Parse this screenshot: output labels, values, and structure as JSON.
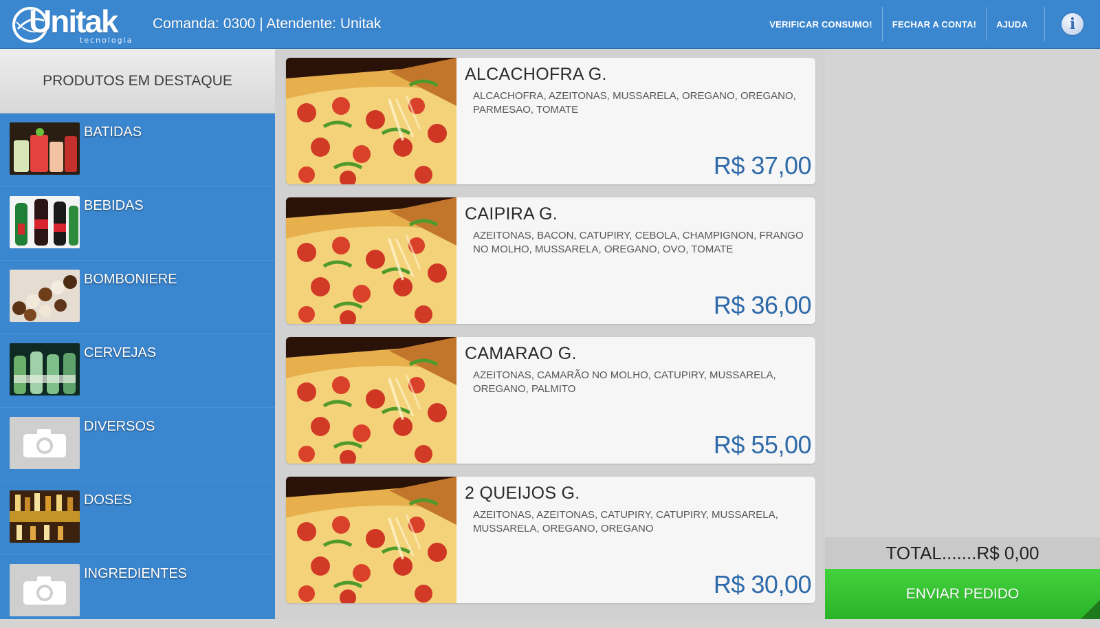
{
  "header": {
    "brand": "Unitak",
    "brand_sub": "tecnologia",
    "session": "Comanda: 0300 | Atendente: Unitak",
    "nav": [
      "VERIFICAR CONSUMO!",
      "FECHAR A CONTA!",
      "AJUDA"
    ],
    "info_icon": "info-icon",
    "accent_color": "#3a86cf"
  },
  "sidebar": {
    "title": "PRODUTOS EM DESTAQUE",
    "categories": [
      {
        "label": "BATIDAS"
      },
      {
        "label": "BEBIDAS"
      },
      {
        "label": "BOMBONIERE"
      },
      {
        "label": "CERVEJAS"
      },
      {
        "label": "DIVERSOS"
      },
      {
        "label": "DOSES"
      },
      {
        "label": "INGREDIENTES"
      }
    ]
  },
  "products": [
    {
      "name": "ALCACHOFRA G.",
      "description": "ALCACHOFRA, AZEITONAS, MUSSARELA, OREGANO, OREGANO, PARMESAO, TOMATE",
      "price": "R$ 37,00"
    },
    {
      "name": "CAIPIRA G.",
      "description": "AZEITONAS, BACON, CATUPIRY, CEBOLA, CHAMPIGNON, FRANGO NO MOLHO, MUSSARELA, OREGANO, OVO, TOMATE",
      "price": "R$ 36,00"
    },
    {
      "name": "CAMARAO G.",
      "description": "AZEITONAS, CAMARÃO NO MOLHO, CATUPIRY, MUSSARELA, OREGANO, PALMITO",
      "price": "R$ 55,00"
    },
    {
      "name": "2 QUEIJOS G.",
      "description": "AZEITONAS, AZEITONAS, CATUPIRY, CATUPIRY, MUSSARELA, MUSSARELA, OREGANO, OREGANO",
      "price": "R$ 30,00"
    }
  ],
  "order": {
    "total": "TOTAL.......R$ 0,00",
    "send_label": "ENVIAR PEDIDO",
    "send_color": "#3cc937"
  }
}
